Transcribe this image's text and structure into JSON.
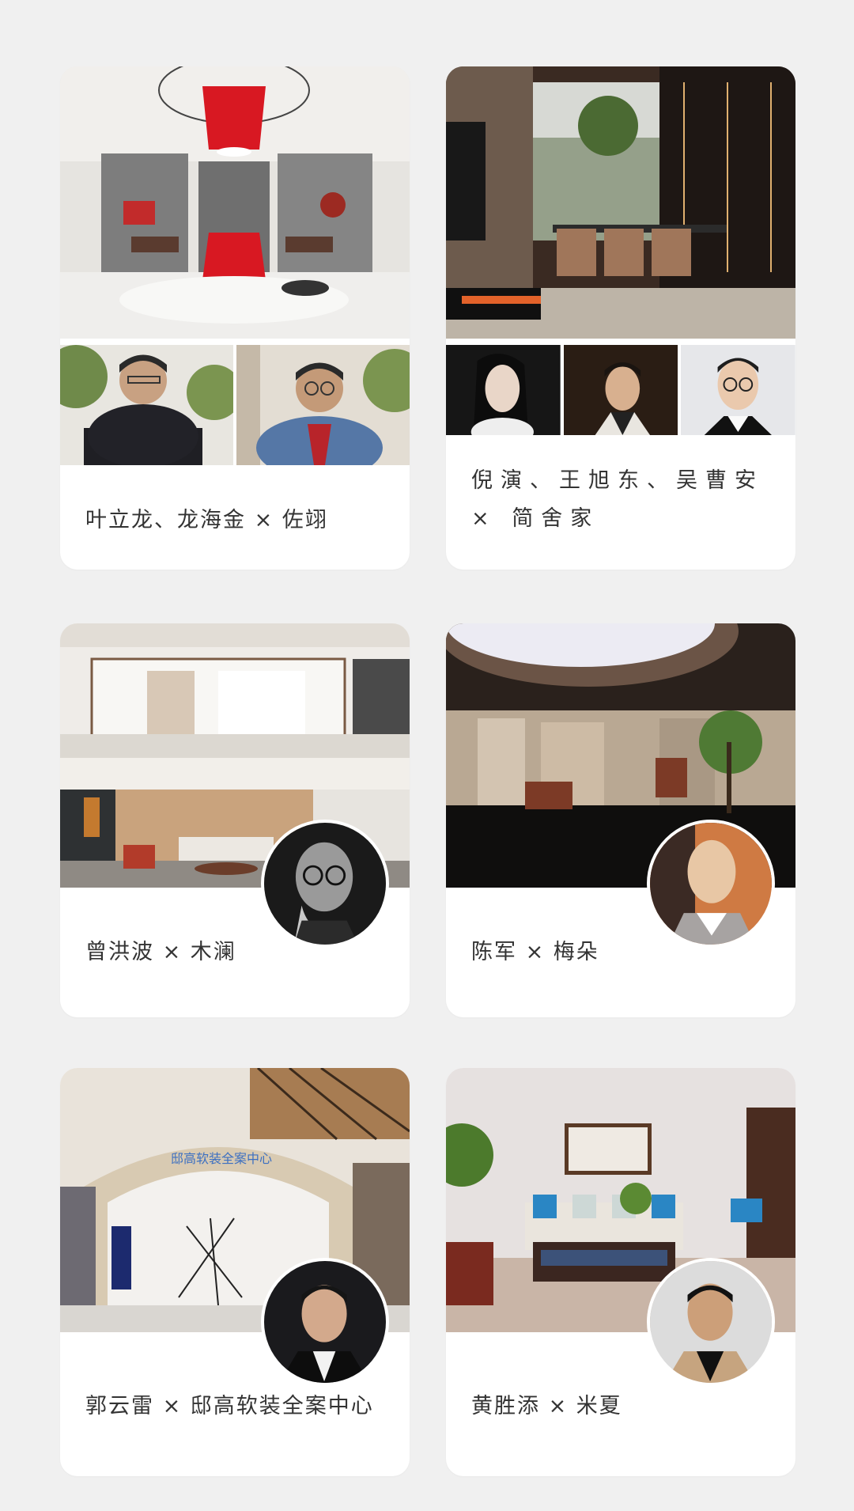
{
  "cards": [
    {
      "label": "叶立龙、龙海金 × 佐翊"
    },
    {
      "label": "倪演、王旭东、吴曹安 × 简舍家"
    },
    {
      "label": "曾洪波 × 木澜"
    },
    {
      "label": "陈军 × 梅朵"
    },
    {
      "label": "郭云雷 × 邸高软装全案中心"
    },
    {
      "label": "黄胜添 × 米夏"
    }
  ],
  "signage": {
    "store_name": "邸高软装全案中心"
  },
  "icons": [
    "person-photo",
    "interior-photo"
  ]
}
